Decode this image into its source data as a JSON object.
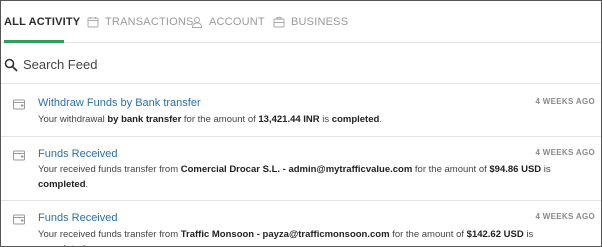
{
  "tabs": [
    {
      "label": "ALL ACTIVITY",
      "icon": "none",
      "active": true
    },
    {
      "label": "TRANSACTIONS",
      "icon": "calendar-icon",
      "active": false
    },
    {
      "label": "ACCOUNT",
      "icon": "user-icon",
      "active": false
    },
    {
      "label": "BUSINESS",
      "icon": "briefcase-icon",
      "active": false
    }
  ],
  "search": {
    "placeholder": "Search Feed",
    "icon": "search-icon"
  },
  "feed": [
    {
      "title": "Withdraw Funds by Bank transfer",
      "time": "4 WEEKS AGO",
      "parts": [
        "Your withdrawal ",
        "by bank transfer",
        " for the amount of ",
        "13,421.44 INR",
        " is ",
        "completed",
        "."
      ]
    },
    {
      "title": "Funds Received",
      "time": "4 WEEKS AGO",
      "parts": [
        "Your received funds transfer from ",
        "Comercial Drocar S.L. - admin@mytrafficvalue.com",
        " for the amount of ",
        "$94.86 USD",
        " is ",
        "completed",
        "."
      ]
    },
    {
      "title": "Funds Received",
      "time": "4 WEEKS AGO",
      "parts": [
        "Your received funds transfer from ",
        "Traffic Monsoon - payza@trafficmonsoon.com",
        " for the amount of ",
        "$142.62 USD",
        " is ",
        "completed",
        "."
      ]
    }
  ],
  "colors": {
    "accent": "#2e9e5b",
    "link": "#2a6fb0"
  }
}
